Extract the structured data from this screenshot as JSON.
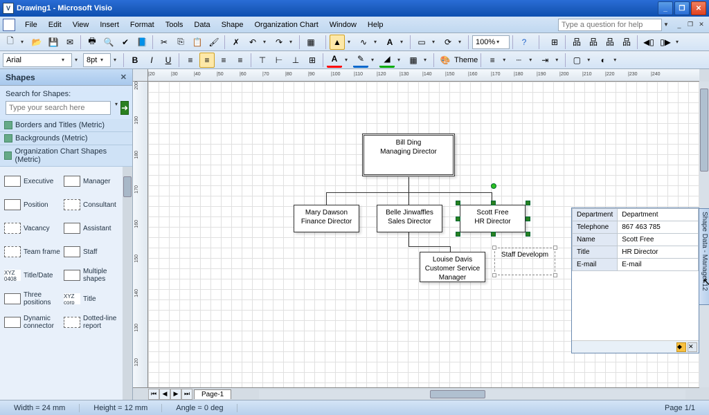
{
  "titlebar": {
    "title": "Drawing1 - Microsoft Visio",
    "icon_letter": "V"
  },
  "help_search": {
    "placeholder": "Type a question for help"
  },
  "menu": {
    "file": "File",
    "edit": "Edit",
    "view": "View",
    "insert": "Insert",
    "format": "Format",
    "tools": "Tools",
    "data": "Data",
    "shape": "Shape",
    "orgchart": "Organization Chart",
    "window": "Window",
    "help": "Help"
  },
  "toolbar": {
    "zoom": "100%",
    "font": "Arial",
    "size": "8pt",
    "theme_label": "Theme"
  },
  "shapes_panel": {
    "title": "Shapes",
    "search_label": "Search for Shapes:",
    "search_placeholder": "Type your search here",
    "stencils": [
      "Borders and Titles (Metric)",
      "Backgrounds (Metric)",
      "Organization Chart Shapes (Metric)"
    ],
    "shapes": [
      [
        "Executive",
        "Manager"
      ],
      [
        "Position",
        "Consultant"
      ],
      [
        "Vacancy",
        "Assistant"
      ],
      [
        "Team frame",
        "Staff"
      ],
      [
        "Title/Date",
        "Multiple shapes"
      ],
      [
        "Three positions",
        "Title"
      ],
      [
        "Dynamic connector",
        "Dotted-line report"
      ]
    ]
  },
  "ruler": {
    "h_ticks": [
      "|20",
      "|30",
      "|40",
      "|50",
      "|60",
      "|70",
      "|80",
      "|90",
      "|100",
      "|110",
      "|120",
      "|130",
      "|140",
      "|150",
      "|160",
      "|170",
      "|180",
      "|190",
      "|200",
      "|210",
      "|220",
      "|230",
      "|240"
    ],
    "v_ticks": [
      "200",
      "190",
      "180",
      "170",
      "160",
      "150",
      "140",
      "130",
      "120"
    ]
  },
  "org": {
    "box1": {
      "name": "Bill Ding",
      "title": "Managing Director"
    },
    "box2": {
      "name": "Mary Dawson",
      "title": "Finance Director"
    },
    "box3": {
      "name": "Belle Jinwaffles",
      "title": "Sales Director"
    },
    "box4": {
      "name": "Scott Free",
      "title": "HR Director"
    },
    "box5": {
      "name": "Louise Davis",
      "title": "Customer Service Manager"
    },
    "dotted": "Staff Developm"
  },
  "shape_data": {
    "tab_title": "Shape Data - Manager.12",
    "rows": [
      {
        "k": "Department",
        "v": "Department"
      },
      {
        "k": "Telephone",
        "v": "867 463 785"
      },
      {
        "k": "Name",
        "v": "Scott Free"
      },
      {
        "k": "Title",
        "v": "HR Director"
      },
      {
        "k": "E-mail",
        "v": "E-mail"
      }
    ]
  },
  "page_tabs": {
    "page1": "Page-1"
  },
  "status": {
    "width": "Width = 24 mm",
    "height": "Height = 12 mm",
    "angle": "Angle = 0 deg",
    "page": "Page 1/1"
  }
}
